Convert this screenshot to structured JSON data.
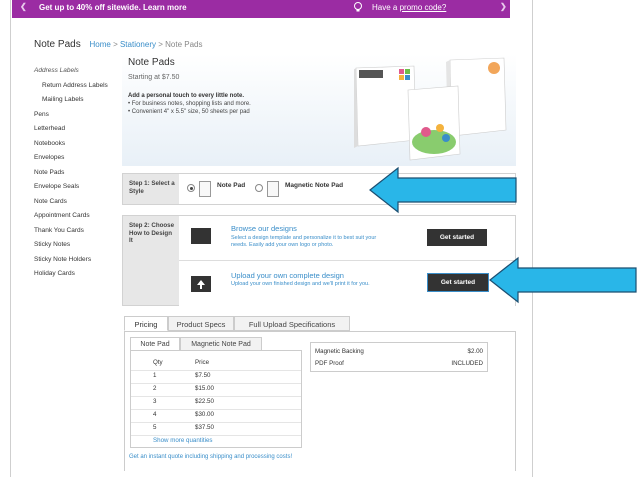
{
  "promo": {
    "message": "Get up to 40% off sitewide. Learn more",
    "promo_prefix": "Have a",
    "promo_link": "promo code?"
  },
  "header": {
    "page_title": "Note Pads",
    "breadcrumb": [
      "Home",
      "Stationery",
      "Note Pads"
    ],
    "separator": ">"
  },
  "sidebar": {
    "items": [
      {
        "label": "Address Labels",
        "style": "italic"
      },
      {
        "label": "Return Address Labels",
        "style": "sub"
      },
      {
        "label": "Mailing Labels",
        "style": "sub"
      },
      {
        "label": "Pens",
        "style": "normal"
      },
      {
        "label": "Letterhead",
        "style": "normal"
      },
      {
        "label": "Notebooks",
        "style": "normal"
      },
      {
        "label": "Envelopes",
        "style": "normal"
      },
      {
        "label": "Note Pads",
        "style": "normal"
      },
      {
        "label": "Envelope Seals",
        "style": "normal"
      },
      {
        "label": "Note Cards",
        "style": "normal"
      },
      {
        "label": "Appointment Cards",
        "style": "normal"
      },
      {
        "label": "Thank You Cards",
        "style": "normal"
      },
      {
        "label": "Sticky Notes",
        "style": "normal"
      },
      {
        "label": "Sticky Note Holders",
        "style": "normal"
      },
      {
        "label": "Holiday Cards",
        "style": "normal"
      }
    ]
  },
  "hero": {
    "title": "Note Pads",
    "starting": "Starting at $7.50",
    "bold_line": "Add a personal touch to every little note.",
    "bullets": [
      "• For business notes, shopping lists and more.",
      "• Convenient 4\" x 5.5\" size, 50 sheets per pad"
    ]
  },
  "step1": {
    "label": "Step 1: Select a Style",
    "options": [
      {
        "label": "Note Pad",
        "selected": true
      },
      {
        "label": "Magnetic Note Pad",
        "selected": false
      }
    ]
  },
  "step2": {
    "label": "Step 2: Choose How to Design It",
    "browse": {
      "title": "Browse our designs",
      "desc": "Select a design template and personalize it to best suit your needs. Easily add your own logo or photo.",
      "button": "Get started"
    },
    "upload": {
      "title": "Upload your own complete design",
      "desc": "Upload your own finished design and we'll print it for you.",
      "button": "Get started"
    }
  },
  "tabs": {
    "items": [
      "Pricing",
      "Product Specs",
      "Full Upload Specifications"
    ],
    "active": 0
  },
  "subtabs": {
    "items": [
      "Note Pad",
      "Magnetic Note Pad"
    ],
    "active": 0
  },
  "pricing": {
    "headers": [
      "Qty",
      "Price"
    ],
    "rows": [
      [
        "1",
        "$7.50"
      ],
      [
        "2",
        "$15.00"
      ],
      [
        "3",
        "$22.50"
      ],
      [
        "4",
        "$30.00"
      ],
      [
        "5",
        "$37.50"
      ]
    ],
    "more": "Show more quantities"
  },
  "addons": [
    {
      "name": "Magnetic Backing",
      "value": "$2.00"
    },
    {
      "name": "PDF Proof",
      "value": "INCLUDED"
    }
  ],
  "quote_link": "Get an instant quote including shipping and processing costs!",
  "colors": {
    "promo_bg": "#9b2ca3",
    "link": "#3a8ec9",
    "button": "#333333",
    "arrow": "#29b6e8"
  }
}
